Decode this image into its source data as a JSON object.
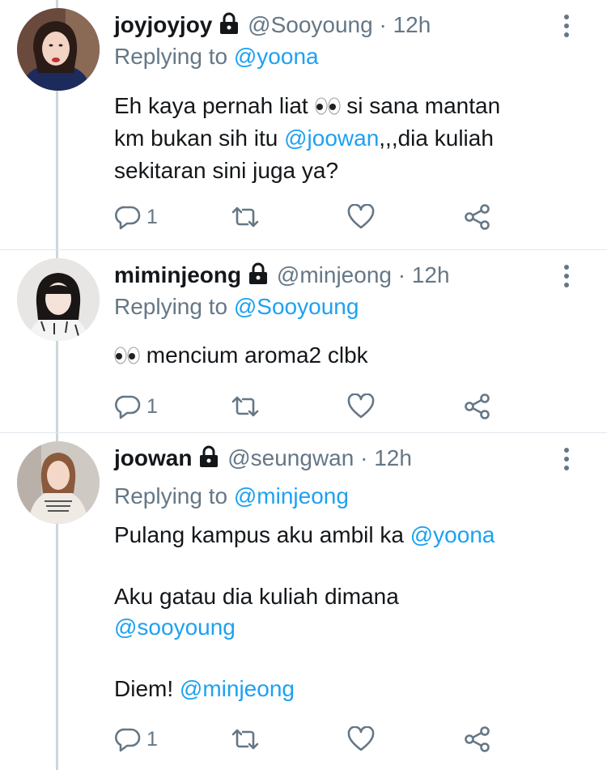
{
  "tweets": [
    {
      "display_name": "joyjoyjoy",
      "handle": "@Sooyoung",
      "time": "12h",
      "replying_prefix": "Replying to",
      "replying_to": "@yoona",
      "body": {
        "l1_pre": "Eh kaya pernah liat",
        "l1_post": " si sana mantan",
        "l2_pre": "km bukan sih itu ",
        "l2_mention": "@joowan",
        "l2_post": ",,,dia kuliah",
        "l3": "sekitaran sini juga ya?"
      },
      "reply_count": "1"
    },
    {
      "display_name": "miminjeong",
      "handle": "@minjeong",
      "time": "12h",
      "replying_prefix": "Replying to",
      "replying_to": "@Sooyoung",
      "body": {
        "l1_post": " mencium aroma2 clbk"
      },
      "reply_count": "1"
    },
    {
      "display_name": "joowan",
      "handle": "@seungwan",
      "time": "12h",
      "replying_prefix": "Replying to",
      "replying_to": "@minjeong",
      "body": {
        "p1_text": "Pulang kampus aku ambil ka ",
        "p1_mention": "@yoona",
        "p2_text": "Aku gatau dia kuliah dimana",
        "p2_mention": "@sooyoung",
        "p3_text": "Diem! ",
        "p3_mention": "@minjeong"
      },
      "reply_count": "1"
    }
  ],
  "separator": "·",
  "colors": {
    "link": "#1da1f2",
    "muted": "#657786",
    "text": "#14171a"
  },
  "icons": [
    "lock-icon",
    "more-vertical-icon",
    "reply-icon",
    "retweet-icon",
    "like-icon",
    "share-icon",
    "eyes-emoji"
  ]
}
